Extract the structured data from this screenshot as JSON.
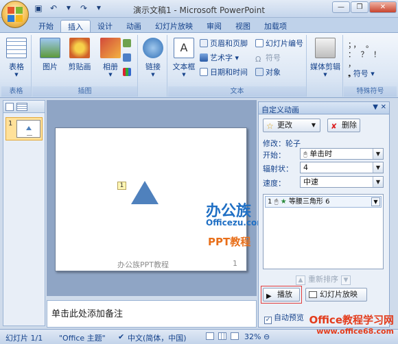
{
  "titlebar": {
    "title": "演示文稿1 - Microsoft PowerPoint",
    "qat_icons": [
      "save-icon",
      "undo-icon",
      "redo-icon",
      "customize-icon"
    ]
  },
  "tabs": [
    "开始",
    "插入",
    "设计",
    "动画",
    "幻灯片放映",
    "审阅",
    "视图",
    "加载项"
  ],
  "active_tab": "插入",
  "ribbon": {
    "groups": {
      "tables": {
        "label": "表格",
        "button": "表格"
      },
      "illustrations": {
        "label": "插图",
        "picture": "图片",
        "clipart": "剪贴画",
        "album": "相册"
      },
      "links": {
        "button": "链接"
      },
      "text": {
        "label": "文本",
        "textbox": "文本框",
        "header_footer": "页眉和页脚",
        "wordart": "艺术字",
        "datetime": "日期和时间",
        "slide_number": "幻灯片编号",
        "symbol": "符号",
        "object": "对象"
      },
      "media": {
        "button": "媒体剪辑"
      },
      "special": {
        "label": "特殊符号",
        "button": "符号",
        "chars": "；，  。  ：  ？  ！  ，"
      }
    }
  },
  "slide": {
    "badge": "1",
    "footer": "办公族PPT教程",
    "number": "1"
  },
  "watermarks": {
    "logo_cn": "办公族",
    "logo_en": "Officezu.com",
    "ppt": "PPT教程",
    "site_cn": "Office教程学习网",
    "site_en": "www.office68.com"
  },
  "thumbnail": {
    "number": "1"
  },
  "notes_placeholder": "单击此处添加备注",
  "pane": {
    "title": "自定义动画",
    "change_btn": "更改",
    "delete_btn": "删除",
    "modify": "修改：轮子",
    "start_label": "开始：",
    "start_value": "单击时",
    "spokes_label": "辐射状：",
    "spokes_value": "4",
    "speed_label": "速度：",
    "speed_value": "中速",
    "list_item": {
      "index": "1",
      "name": "等腰三角形 6"
    },
    "reorder": "重新排序",
    "play_btn": "播放",
    "slideshow_btn": "幻灯片放映",
    "autopreview": "自动预览"
  },
  "statusbar": {
    "slide": "幻灯片 1/1",
    "theme": "\"Office 主题\"",
    "language": "中文(简体，中国)",
    "zoom": "32%"
  }
}
